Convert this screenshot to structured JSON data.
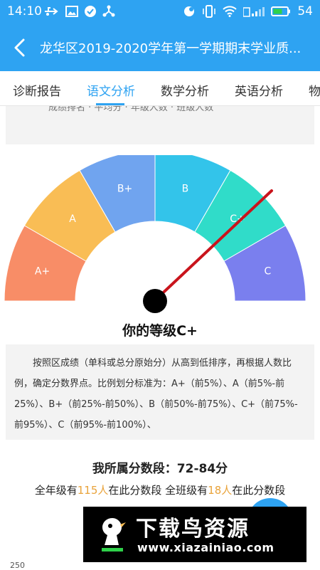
{
  "status_bar": {
    "time": "14:10",
    "battery": "54",
    "icons": [
      "usb-icon",
      "image-icon",
      "check-circle-icon",
      "share-icon",
      "notification-icon",
      "vibrate-icon",
      "wifi-icon",
      "sim-signal-icon",
      "battery-icon"
    ],
    "bg_color": "#2ea3f2"
  },
  "app_bar": {
    "title": "龙华区2019-2020学年第一学期期末学业质..."
  },
  "tabs": [
    {
      "label": "诊断报告",
      "active": false
    },
    {
      "label": "语文分析",
      "active": true
    },
    {
      "label": "数学分析",
      "active": false
    },
    {
      "label": "英语分析",
      "active": false
    },
    {
      "label": "物",
      "active": false
    }
  ],
  "accent_color": "#2ea3f2",
  "gauge": {
    "segments": [
      {
        "label": "A+",
        "color": "#f88d67"
      },
      {
        "label": "A",
        "color": "#f9bd55"
      },
      {
        "label": "B+",
        "color": "#70a4ef"
      },
      {
        "label": "B",
        "color": "#33c4ea"
      },
      {
        "label": "C+",
        "color": "#30dcc9"
      },
      {
        "label": "C",
        "color": "#7a7fee"
      }
    ],
    "needle_segment": "C+",
    "needle_color": "#c9141c"
  },
  "grade_text": "你的等级C+",
  "description": "按照区成绩（单科或总分原始分）从高到低排序，再根据人数比例，确定分数界点。比例划分标准为：A+（前5%）、A（前5%-前25%）、B+（前25%-前50%）、B（前50%-前75%）、C+（前75%-前95%）、C（前95%-前100%）、",
  "segment": {
    "title": "我所属分数段：72-84分",
    "grade_prefix": "全年级有",
    "grade_count": "115人",
    "grade_suffix": "在此分数段 全班级有",
    "class_count": "18人",
    "class_suffix": "在此分数段",
    "highlight_color": "#e9a33b"
  },
  "watermark": {
    "cn": "下载鸟资源",
    "en": "www.xiazainiao.com"
  },
  "chart_axis_tick": "250"
}
